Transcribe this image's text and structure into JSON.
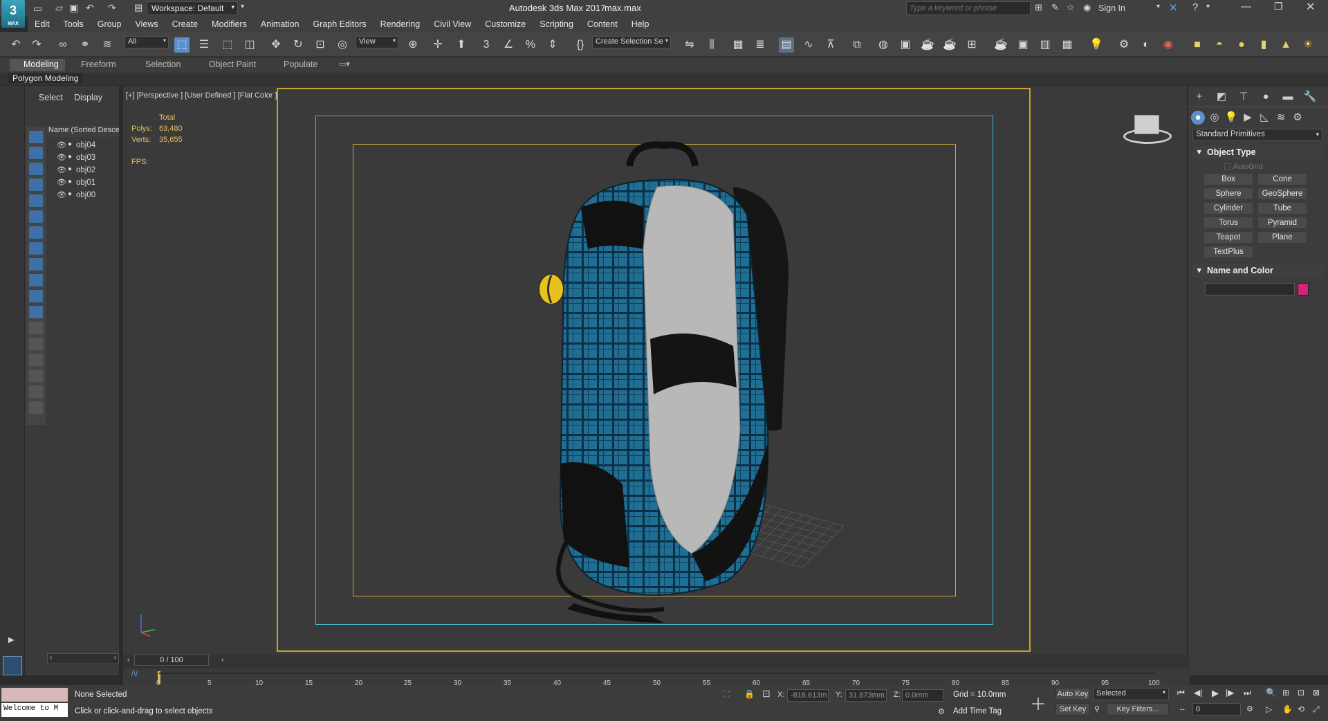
{
  "titlebar": {
    "workspace": "Workspace: Default",
    "title": "Autodesk 3ds Max 2017",
    "file": "max.max",
    "search_placeholder": "Type a keyword or phrase",
    "sign_in": "Sign In"
  },
  "logo": {
    "main": "3",
    "sub": "MAX"
  },
  "menu": [
    "Edit",
    "Tools",
    "Group",
    "Views",
    "Create",
    "Modifiers",
    "Animation",
    "Graph Editors",
    "Rendering",
    "Civil View",
    "Customize",
    "Scripting",
    "Content",
    "Help"
  ],
  "toolbar": {
    "filter": "All",
    "ref_coord": "View",
    "selection_set": "Create Selection Se"
  },
  "ribbon": {
    "tabs": [
      "Modeling",
      "Freeform",
      "Selection",
      "Object Paint",
      "Populate"
    ],
    "active": "Modeling",
    "sub": "Polygon Modeling"
  },
  "explorer": {
    "tabs": [
      "Select",
      "Display"
    ],
    "column": "Name (Sorted Descen",
    "items": [
      "obj04",
      "obj03",
      "obj02",
      "obj01",
      "obj00"
    ]
  },
  "viewport": {
    "label": "[+] [Perspective ] [User Defined ] [Flat Color ]",
    "stats": {
      "header": "Total",
      "polys_label": "Polys:",
      "polys": "63,480",
      "verts_label": "Verts:",
      "verts": "35,655",
      "fps_label": "FPS:"
    }
  },
  "command_panel": {
    "dropdown": "Standard Primitives",
    "object_type": "Object Type",
    "autogrid": "AutoGrid",
    "primitives": [
      "Box",
      "Cone",
      "Sphere",
      "GeoSphere",
      "Cylinder",
      "Tube",
      "Torus",
      "Pyramid",
      "Teapot",
      "Plane",
      "TextPlus"
    ],
    "name_and_color": "Name and Color",
    "color": "#d6237a"
  },
  "timeline": {
    "frame": "0 / 100",
    "ticks": [
      "0",
      "5",
      "10",
      "15",
      "20",
      "25",
      "30",
      "35",
      "40",
      "45",
      "50",
      "55",
      "60",
      "65",
      "70",
      "75",
      "80",
      "85",
      "90",
      "95",
      "100"
    ]
  },
  "status": {
    "maxscript": "Welcome to M",
    "selection": "None Selected",
    "prompt": "Click or click-and-drag to select objects",
    "x_label": "X:",
    "x": "-816.613m",
    "y_label": "Y:",
    "y": "31.873mm",
    "z_label": "Z:",
    "z": "0.0mm",
    "grid": "Grid = 10.0mm",
    "add_time_tag": "Add Time Tag",
    "auto_key": "Auto Key",
    "set_key": "Set Key",
    "key_mode": "Selected",
    "key_filters": "Key Filters...",
    "frame_value": "0"
  }
}
